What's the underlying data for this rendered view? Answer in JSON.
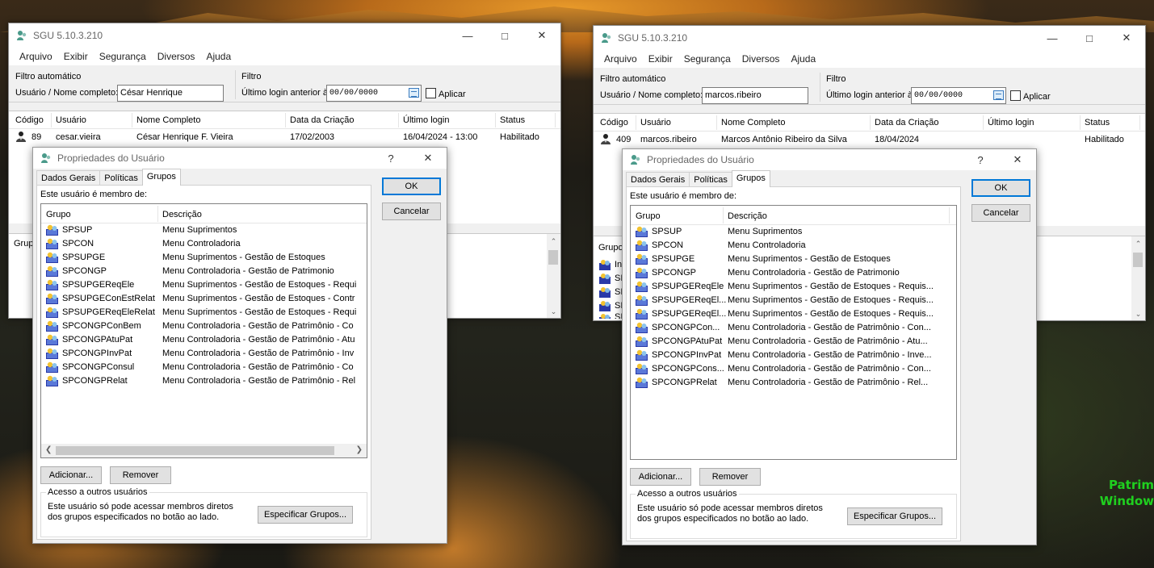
{
  "window_left": {
    "title": "SGU 5.10.3.210",
    "menu": [
      "Arquivo",
      "Exibir",
      "Segurança",
      "Diversos",
      "Ajuda"
    ],
    "filter_auto_label": "Filtro automático",
    "user_field_label": "Usuário / Nome completo:",
    "user_field_value": "César Henrique",
    "filter_label": "Filtro",
    "last_login_label": "Último login anterior à:",
    "date_value": "00/00/0000",
    "apply_label": "Aplicar",
    "columns": [
      "Código",
      "Usuário",
      "Nome Completo",
      "Data da Criação",
      "Último login",
      "Status"
    ],
    "row": {
      "code": "89",
      "user": "cesar.vieira",
      "name": "César Henrique F. Vieira",
      "created": "17/02/2003",
      "last_login": "16/04/2024 - 13:00",
      "status": "Habilitado"
    },
    "lower_label": "Grup"
  },
  "window_right": {
    "title": "SGU 5.10.3.210",
    "menu": [
      "Arquivo",
      "Exibir",
      "Segurança",
      "Diversos",
      "Ajuda"
    ],
    "filter_auto_label": "Filtro automático",
    "user_field_label": "Usuário / Nome completo:",
    "user_field_value": "marcos.ribeiro",
    "filter_label": "Filtro",
    "last_login_label": "Último login anterior à:",
    "date_value": "00/00/0000",
    "apply_label": "Aplicar",
    "columns": [
      "Código",
      "Usuário",
      "Nome Completo",
      "Data da Criação",
      "Último login",
      "Status"
    ],
    "row": {
      "code": "409",
      "user": "marcos.ribeiro",
      "name": "Marcos Antônio Ribeiro da Silva",
      "created": "18/04/2024",
      "last_login": "",
      "status": "Habilitado"
    },
    "lower_label": "Grupo",
    "lower_items": [
      "In",
      "SI",
      "SI",
      "SI",
      "SI"
    ]
  },
  "dialog_left": {
    "title": "Propriedades do Usuário",
    "help": "?",
    "tabs": [
      "Dados Gerais",
      "Políticas",
      "Grupos"
    ],
    "member_label": "Este usuário é membro de:",
    "col_group": "Grupo",
    "col_desc": "Descrição",
    "groups": [
      {
        "name": "SPSUP",
        "desc": "Menu Suprimentos"
      },
      {
        "name": "SPCON",
        "desc": "Menu Controladoria"
      },
      {
        "name": "SPSUPGE",
        "desc": "Menu Suprimentos - Gestão de Estoques"
      },
      {
        "name": "SPCONGP",
        "desc": "Menu Controladoria - Gestão de Patrimonio"
      },
      {
        "name": "SPSUPGEReqEle",
        "desc": "Menu Suprimentos - Gestão de Estoques - Requi"
      },
      {
        "name": "SPSUPGEConEstRelat",
        "desc": "Menu Suprimentos - Gestão de Estoques - Contr"
      },
      {
        "name": "SPSUPGEReqEleRelat",
        "desc": "Menu Suprimentos - Gestão de Estoques - Requi"
      },
      {
        "name": "SPCONGPConBem",
        "desc": "Menu Controladoria - Gestão de Patrimônio - Co"
      },
      {
        "name": "SPCONGPAtuPat",
        "desc": "Menu Controladoria - Gestão de Patrimônio - Atu"
      },
      {
        "name": "SPCONGPInvPat",
        "desc": "Menu Controladoria - Gestão de Patrimônio - Inv"
      },
      {
        "name": "SPCONGPConsul",
        "desc": "Menu Controladoria - Gestão de Patrimônio - Co"
      },
      {
        "name": "SPCONGPRelat",
        "desc": "Menu Controladoria - Gestão de Patrimônio - Rel"
      }
    ],
    "add_label": "Adicionar...",
    "remove_label": "Remover",
    "access_legend": "Acesso a outros usuários",
    "access_desc": "Este usuário só pode acessar membros diretos dos grupos especificados no botão ao lado.",
    "specify_label": "Especificar Grupos...",
    "ok_label": "OK",
    "cancel_label": "Cancelar"
  },
  "dialog_right": {
    "title": "Propriedades do Usuário",
    "help": "?",
    "tabs": [
      "Dados Gerais",
      "Políticas",
      "Grupos"
    ],
    "member_label": "Este usuário é membro de:",
    "col_group": "Grupo",
    "col_desc": "Descrição",
    "groups": [
      {
        "name": "SPSUP",
        "desc": "Menu Suprimentos"
      },
      {
        "name": "SPCON",
        "desc": "Menu Controladoria"
      },
      {
        "name": "SPSUPGE",
        "desc": "Menu Suprimentos - Gestão de Estoques"
      },
      {
        "name": "SPCONGP",
        "desc": "Menu Controladoria - Gestão de Patrimonio"
      },
      {
        "name": "SPSUPGEReqEle",
        "desc": "Menu Suprimentos - Gestão de Estoques - Requis..."
      },
      {
        "name": "SPSUPGEReqEl...",
        "desc": "Menu Suprimentos - Gestão de Estoques - Requis..."
      },
      {
        "name": "SPSUPGEReqEl...",
        "desc": "Menu Suprimentos - Gestão de Estoques - Requis..."
      },
      {
        "name": "SPCONGPCon...",
        "desc": "Menu Controladoria - Gestão de Patrimônio - Con..."
      },
      {
        "name": "SPCONGPAtuPat",
        "desc": "Menu Controladoria - Gestão de Patrimônio - Atu..."
      },
      {
        "name": "SPCONGPInvPat",
        "desc": "Menu Controladoria - Gestão de Patrimônio - Inve..."
      },
      {
        "name": "SPCONGPCons...",
        "desc": "Menu Controladoria - Gestão de Patrimônio - Con..."
      },
      {
        "name": "SPCONGPRelat",
        "desc": "Menu Controladoria - Gestão de Patrimônio - Rel..."
      }
    ],
    "add_label": "Adicionar...",
    "remove_label": "Remover",
    "access_legend": "Acesso a outros usuários",
    "access_desc": "Este usuário só pode acessar membros diretos dos grupos especificados no botão ao lado.",
    "specify_label": "Especificar Grupos...",
    "ok_label": "OK",
    "cancel_label": "Cancelar"
  },
  "watermark": {
    "line1": "Patrim",
    "line2": "Window"
  },
  "colors": {
    "accent": "#0078d7",
    "watermark": "#1fd01f"
  },
  "icons": {
    "app": "sgu-app-icon",
    "user": "user-icon",
    "group": "group-icon",
    "calendar": "calendar-icon"
  }
}
